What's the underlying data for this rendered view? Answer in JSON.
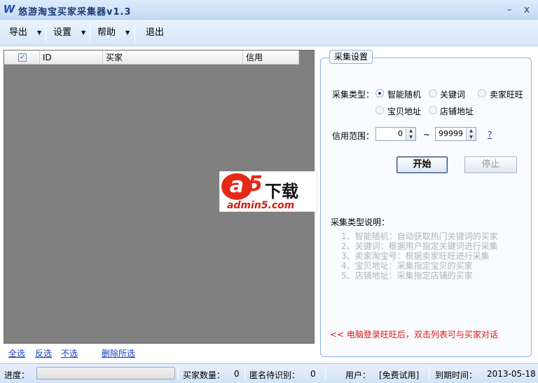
{
  "window": {
    "title": "悠游淘宝买家采集器v1.3",
    "minimize": "–",
    "close": "x"
  },
  "menu": [
    {
      "label": "导出",
      "arrow": "▼"
    },
    {
      "label": "设置",
      "arrow": "▼"
    },
    {
      "label": "帮助",
      "arrow": "▼"
    },
    {
      "label": "退出"
    }
  ],
  "list": {
    "check_glyph": "✓",
    "columns": [
      "ID",
      "买家",
      "信用"
    ]
  },
  "watermark": {
    "a": "a",
    "five": "5",
    "xiazai": "下载",
    "url": "admin5.com"
  },
  "links": [
    "全选",
    "反选",
    "不选",
    "删除所选"
  ],
  "settings": {
    "group_title": "采集设置",
    "type_label": "采集类型：",
    "options": [
      {
        "label": "智能随机",
        "selected": true
      },
      {
        "label": "关键词",
        "selected": false
      },
      {
        "label": "卖家旺旺",
        "selected": false
      },
      {
        "label": "宝贝地址",
        "selected": false
      },
      {
        "label": "店铺地址",
        "selected": false
      }
    ],
    "range_label": "信用范围：",
    "range_min": "0",
    "tilde": "~",
    "range_max": "99999",
    "help": "?",
    "start": "开始",
    "stop": "停止",
    "spin_up": "▲",
    "spin_down": "▼"
  },
  "description": {
    "title": "采集类型说明：",
    "lines": [
      "1、智能随机：自动获取热门关键词的买家",
      "2、关键词：根据用户指定关键词进行采集",
      "3、卖家淘宝号：根据卖家旺旺进行采集",
      "4、宝贝地址：采集指定宝贝的买家",
      "5、店铺地址：采集指定店铺的买家"
    ]
  },
  "hint": "<< 电脑登录旺旺后，双击列表可与买家对话",
  "status": {
    "progress_label": "进度：",
    "buyer_count_label": "买家数量：",
    "buyer_count": "0",
    "anon_label": "匿名待识别：",
    "anon_count": "0",
    "user_label": "用户：",
    "user_value": "[免费试用]",
    "expire_label": "到期时间：",
    "expire_value": "2013-05-18"
  }
}
